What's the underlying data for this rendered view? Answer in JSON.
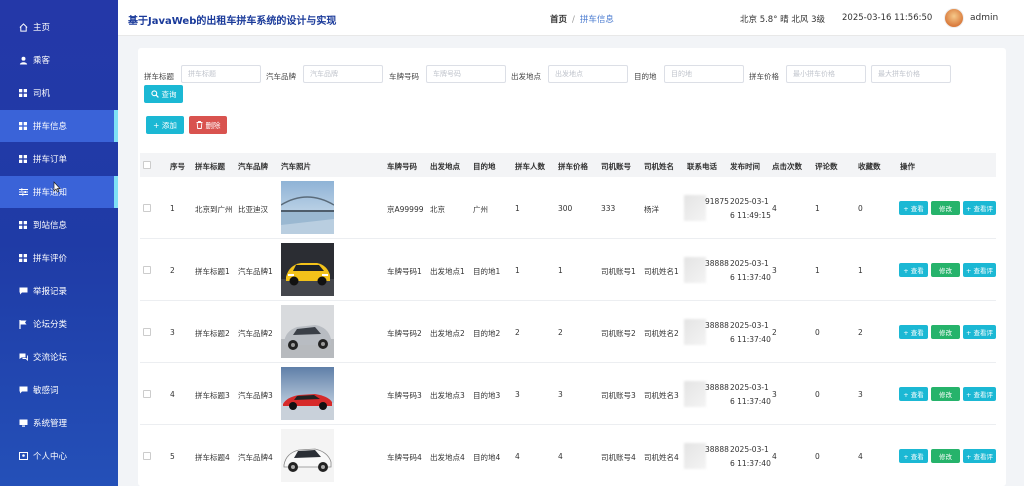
{
  "header": {
    "title": "基于JavaWeb的出租车拼车系统的设计与实现",
    "breadcrumb": {
      "home": "首页",
      "sep": "/",
      "current": "拼车信息"
    },
    "weather": "北京  5.8°  晴  北风  3级",
    "datetime": "2025-03-16 11:56:50",
    "username": "admin"
  },
  "sidebar": {
    "items": [
      {
        "label": "主页",
        "icon": "home-icon"
      },
      {
        "label": "乘客",
        "icon": "user-icon"
      },
      {
        "label": "司机",
        "icon": "grid-icon"
      },
      {
        "label": "拼车信息",
        "icon": "grid-icon",
        "active": true
      },
      {
        "label": "拼车订单",
        "icon": "grid-icon"
      },
      {
        "label": "拼车通知",
        "icon": "sliders-icon",
        "active": true
      },
      {
        "label": "到站信息",
        "icon": "grid-icon"
      },
      {
        "label": "拼车评价",
        "icon": "grid-icon"
      },
      {
        "label": "举报记录",
        "icon": "chat-icon"
      },
      {
        "label": "论坛分类",
        "icon": "flag-icon"
      },
      {
        "label": "交流论坛",
        "icon": "forum-icon"
      },
      {
        "label": "敏感词",
        "icon": "chat-icon"
      },
      {
        "label": "系统管理",
        "icon": "monitor-icon"
      },
      {
        "label": "个人中心",
        "icon": "person-icon"
      }
    ]
  },
  "search": {
    "fields": [
      {
        "label": "拼车标题",
        "placeholder": "拼车标题"
      },
      {
        "label": "汽车品牌",
        "placeholder": "汽车品牌"
      },
      {
        "label": "车牌号码",
        "placeholder": "车牌号码"
      },
      {
        "label": "出发地点",
        "placeholder": "出发地点"
      },
      {
        "label": "目的地",
        "placeholder": "目的地"
      },
      {
        "label": "拼车价格",
        "placeholder": "最小拼车价格"
      }
    ],
    "max_price_placeholder": "最大拼车价格",
    "query_label": "查询"
  },
  "toolbar": {
    "add_label": "+ 添加",
    "delete_label": "删除"
  },
  "table": {
    "columns": [
      "序号",
      "拼车标题",
      "汽车品牌",
      "汽车照片",
      "车牌号码",
      "出发地点",
      "目的地",
      "拼车人数",
      "拼车价格",
      "司机账号",
      "司机姓名",
      "联系电话",
      "发布时间",
      "点击次数",
      "评论数",
      "收藏数",
      "操作"
    ],
    "rows": [
      {
        "no": "1",
        "title": "北京到广州",
        "brand": "比亚迪汉",
        "plate": "京A99999",
        "from": "北京",
        "to": "广州",
        "seats": "1",
        "price": "300",
        "driver_acct": "333",
        "driver_name": "杨洋",
        "phone": "91875",
        "time1": "2025-03-1",
        "time2": "6 11:49:15",
        "clicks": "4",
        "comments": "1",
        "favs": "0",
        "photo": "bridge"
      },
      {
        "no": "2",
        "title": "拼车标题1",
        "brand": "汽车品牌1",
        "plate": "车牌号码1",
        "from": "出发地点1",
        "to": "目的地1",
        "seats": "1",
        "price": "1",
        "driver_acct": "司机账号1",
        "driver_name": "司机姓名1",
        "phone": "38888",
        "time1": "2025-03-1",
        "time2": "6 11:37:40",
        "clicks": "3",
        "comments": "1",
        "favs": "1",
        "photo": "yellow"
      },
      {
        "no": "3",
        "title": "拼车标题2",
        "brand": "汽车品牌2",
        "plate": "车牌号码2",
        "from": "出发地点2",
        "to": "目的地2",
        "seats": "2",
        "price": "2",
        "driver_acct": "司机账号2",
        "driver_name": "司机姓名2",
        "phone": "38888",
        "time1": "2025-03-1",
        "time2": "6 11:37:40",
        "clicks": "2",
        "comments": "0",
        "favs": "2",
        "photo": "silver"
      },
      {
        "no": "4",
        "title": "拼车标题3",
        "brand": "汽车品牌3",
        "plate": "车牌号码3",
        "from": "出发地点3",
        "to": "目的地3",
        "seats": "3",
        "price": "3",
        "driver_acct": "司机账号3",
        "driver_name": "司机姓名3",
        "phone": "38888",
        "time1": "2025-03-1",
        "time2": "6 11:37:40",
        "clicks": "3",
        "comments": "0",
        "favs": "3",
        "photo": "red"
      },
      {
        "no": "5",
        "title": "拼车标题4",
        "brand": "汽车品牌4",
        "plate": "车牌号码4",
        "from": "出发地点4",
        "to": "目的地4",
        "seats": "4",
        "price": "4",
        "driver_acct": "司机账号4",
        "driver_name": "司机姓名4",
        "phone": "38888",
        "time1": "2025-03-1",
        "time2": "6 11:37:40",
        "clicks": "4",
        "comments": "0",
        "favs": "4",
        "photo": "white"
      }
    ],
    "actions": {
      "view": "+ 查看",
      "edit": "修改",
      "view_reviews": "+ 查看评"
    }
  }
}
